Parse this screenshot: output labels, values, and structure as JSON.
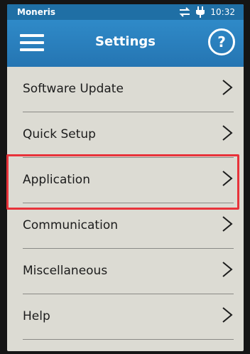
{
  "status_bar": {
    "carrier": "Moneris",
    "time": "10:32"
  },
  "app_bar": {
    "title": "Settings",
    "help_label": "?"
  },
  "menu": {
    "items": [
      {
        "label": "Software Update"
      },
      {
        "label": "Quick Setup"
      },
      {
        "label": "Application",
        "highlighted": true
      },
      {
        "label": "Communication"
      },
      {
        "label": "Miscellaneous"
      },
      {
        "label": "Help"
      }
    ]
  },
  "colors": {
    "header": "#2f8ac8",
    "background": "#dcdbd3",
    "highlight": "#e8323a"
  }
}
